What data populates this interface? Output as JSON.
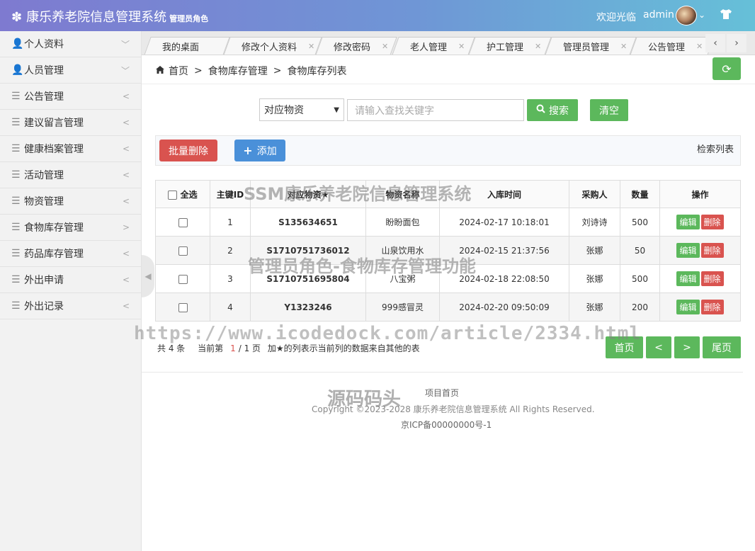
{
  "header": {
    "logo_icon": "gear-icon",
    "title": "康乐养老院信息管理系统",
    "role": "管理员角色",
    "welcome": "欢迎光临",
    "user": "admin",
    "caret": "⌄",
    "theme_icon": "shirt-icon"
  },
  "sidebar": {
    "items": [
      {
        "label": "个人资料",
        "icon": "user-icon",
        "arrow": "﹀"
      },
      {
        "label": "人员管理",
        "icon": "user-icon",
        "arrow": "﹀"
      },
      {
        "label": "公告管理",
        "icon": "list-icon",
        "arrow": "<"
      },
      {
        "label": "建议留言管理",
        "icon": "list-icon",
        "arrow": "<"
      },
      {
        "label": "健康档案管理",
        "icon": "list-icon",
        "arrow": "<"
      },
      {
        "label": "活动管理",
        "icon": "list-icon",
        "arrow": "<"
      },
      {
        "label": "物资管理",
        "icon": "list-icon",
        "arrow": "<"
      },
      {
        "label": "食物库存管理",
        "icon": "list-icon",
        "arrow": ">"
      },
      {
        "label": "药品库存管理",
        "icon": "list-icon",
        "arrow": "<"
      },
      {
        "label": "外出申请",
        "icon": "list-icon",
        "arrow": "<"
      },
      {
        "label": "外出记录",
        "icon": "list-icon",
        "arrow": "<"
      }
    ]
  },
  "tabs": [
    "我的桌面",
    "修改个人资料",
    "修改密码",
    "老人管理",
    "护工管理",
    "管理员管理",
    "公告管理"
  ],
  "breadcrumb": [
    "首页",
    "食物库存管理",
    "食物库存列表"
  ],
  "search": {
    "field": "对应物资",
    "placeholder": "请输入查找关键字",
    "search_label": "搜索",
    "clear_label": "清空"
  },
  "actions": {
    "batch_delete": "批量删除",
    "add": "添加",
    "list_label": "检索列表"
  },
  "table": {
    "headers": [
      "全选",
      "主键ID",
      "对应物资★",
      "物资名称",
      "入库时间",
      "采购人",
      "数量",
      "操作"
    ],
    "rows": [
      {
        "id": "1",
        "code": "S135634651",
        "name": "盼盼面包",
        "time": "2024-02-17 10:18:01",
        "buyer": "刘诗诗",
        "qty": "500"
      },
      {
        "id": "2",
        "code": "S1710751736012",
        "name": "山泉饮用水",
        "time": "2024-02-15 21:37:56",
        "buyer": "张娜",
        "qty": "50"
      },
      {
        "id": "3",
        "code": "S1710751695804",
        "name": "八宝粥",
        "time": "2024-02-18 22:08:50",
        "buyer": "张娜",
        "qty": "500"
      },
      {
        "id": "4",
        "code": "Y1323246",
        "name": "999感冒灵",
        "time": "2024-02-20 09:50:09",
        "buyer": "张娜",
        "qty": "200"
      }
    ],
    "edit_label": "编辑",
    "delete_label": "删除"
  },
  "pagination": {
    "total": "共 4 条",
    "current_prefix": "当前第",
    "current": "1",
    "of": "/ 1 页",
    "note": "加★的列表示当前列的数据来自其他的表",
    "first": "首页",
    "prev": "<",
    "next": ">",
    "last": "尾页"
  },
  "footer": {
    "home": "项目首页",
    "copyright": "Copyright ©2023-2028 康乐养老院信息管理系统 All Rights Reserved.",
    "icp": "京ICP备00000000号-1"
  },
  "watermarks": {
    "w1": "SSM康乐养老院信息管理系统",
    "w2": "管理员角色-食物库存管理功能",
    "w3": "https://www.icodedock.com/article/2334.html",
    "w4": "源码码头"
  },
  "colors": {
    "green": "#5cb85c",
    "red": "#d9534f",
    "blue": "#4a90d9",
    "code_red": "#a0262c"
  }
}
